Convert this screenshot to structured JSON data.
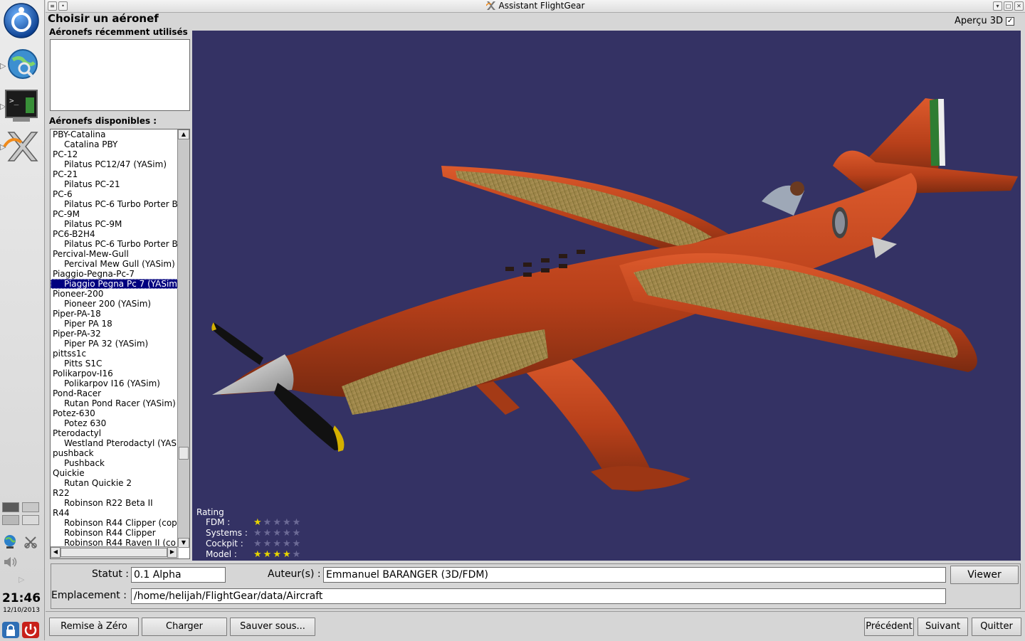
{
  "window": {
    "title": "Assistant FlightGear",
    "heading": "Choisir un aéronef",
    "preview_3d_label": "Aperçu 3D",
    "preview_3d_checked": "✓"
  },
  "recent": {
    "label": "Aéronefs récemment utilisés",
    "items": []
  },
  "available": {
    "label": "Aéronefs disponibles :",
    "items": [
      {
        "text": "PBY-Catalina",
        "kind": "group"
      },
      {
        "text": "Catalina PBY",
        "kind": "variant"
      },
      {
        "text": "PC-12",
        "kind": "group"
      },
      {
        "text": "Pilatus PC12/47 (YASim)",
        "kind": "variant"
      },
      {
        "text": "PC-21",
        "kind": "group"
      },
      {
        "text": "Pilatus PC-21",
        "kind": "variant"
      },
      {
        "text": "PC-6",
        "kind": "group"
      },
      {
        "text": "Pilatus PC-6 Turbo Porter B",
        "kind": "variant"
      },
      {
        "text": "PC-9M",
        "kind": "group"
      },
      {
        "text": "Pilatus PC-9M",
        "kind": "variant"
      },
      {
        "text": "PC6-B2H4",
        "kind": "group"
      },
      {
        "text": "Pilatus PC-6 Turbo Porter B",
        "kind": "variant"
      },
      {
        "text": "Percival-Mew-Gull",
        "kind": "group"
      },
      {
        "text": "Percival Mew Gull (YASim)",
        "kind": "variant"
      },
      {
        "text": "Piaggio-Pegna-Pc-7",
        "kind": "group"
      },
      {
        "text": "Piaggio Pegna Pc 7 (YASim",
        "kind": "variant",
        "selected": true
      },
      {
        "text": "Pioneer-200",
        "kind": "group"
      },
      {
        "text": "Pioneer 200 (YASim)",
        "kind": "variant"
      },
      {
        "text": "Piper-PA-18",
        "kind": "group"
      },
      {
        "text": "Piper PA 18",
        "kind": "variant"
      },
      {
        "text": "Piper-PA-32",
        "kind": "group"
      },
      {
        "text": "Piper PA 32 (YASim)",
        "kind": "variant"
      },
      {
        "text": "pittss1c",
        "kind": "group"
      },
      {
        "text": "Pitts S1C",
        "kind": "variant"
      },
      {
        "text": "Polikarpov-I16",
        "kind": "group"
      },
      {
        "text": "Polikarpov I16 (YASim)",
        "kind": "variant"
      },
      {
        "text": "Pond-Racer",
        "kind": "group"
      },
      {
        "text": "Rutan Pond Racer (YASim)",
        "kind": "variant"
      },
      {
        "text": "Potez-630",
        "kind": "group"
      },
      {
        "text": "Potez 630",
        "kind": "variant"
      },
      {
        "text": "Pterodactyl",
        "kind": "group"
      },
      {
        "text": "Westland Pterodactyl (YAS",
        "kind": "variant"
      },
      {
        "text": "pushback",
        "kind": "group"
      },
      {
        "text": "Pushback",
        "kind": "variant"
      },
      {
        "text": "Quickie",
        "kind": "group"
      },
      {
        "text": "Rutan Quickie 2",
        "kind": "variant"
      },
      {
        "text": "R22",
        "kind": "group"
      },
      {
        "text": "Robinson R22 Beta II",
        "kind": "variant"
      },
      {
        "text": "R44",
        "kind": "group"
      },
      {
        "text": "Robinson R44 Clipper (cop",
        "kind": "variant"
      },
      {
        "text": "Robinson R44 Clipper",
        "kind": "variant"
      },
      {
        "text": "Robinson R44 Raven II (co",
        "kind": "variant"
      }
    ]
  },
  "rating": {
    "title": "Rating",
    "rows": [
      {
        "label": "FDM :",
        "stars": 1
      },
      {
        "label": "Systems :",
        "stars": 0
      },
      {
        "label": "Cockpit :",
        "stars": 0
      },
      {
        "label": "Model :",
        "stars": 4
      }
    ],
    "max_stars": 5
  },
  "info": {
    "status_label": "Statut :",
    "status_value": "0.1 Alpha",
    "authors_label": "Auteur(s) :",
    "authors_value": "Emmanuel BARANGER (3D/FDM)",
    "viewer_button": "Viewer",
    "location_label": "Emplacement :",
    "location_value": "/home/helijah/FlightGear/data/Aircraft"
  },
  "buttons": {
    "reset": "Remise à Zéro",
    "load": "Charger",
    "save_as": "Sauver sous...",
    "previous": "Précédent",
    "next": "Suivant",
    "quit": "Quitter"
  },
  "clock": {
    "time": "21:46",
    "date": "12/10/2013"
  },
  "colors": {
    "viewport_bg": "#343264",
    "selection": "#00007f",
    "star_on": "#e6d400",
    "aircraft_body": "#c2461c"
  },
  "icons": {
    "dock": [
      "app-menu-icon",
      "web-browser-icon",
      "terminal-icon",
      "flightgear-icon",
      "network-icon",
      "tools-icon",
      "volume-icon",
      "lock-icon",
      "power-icon"
    ]
  }
}
